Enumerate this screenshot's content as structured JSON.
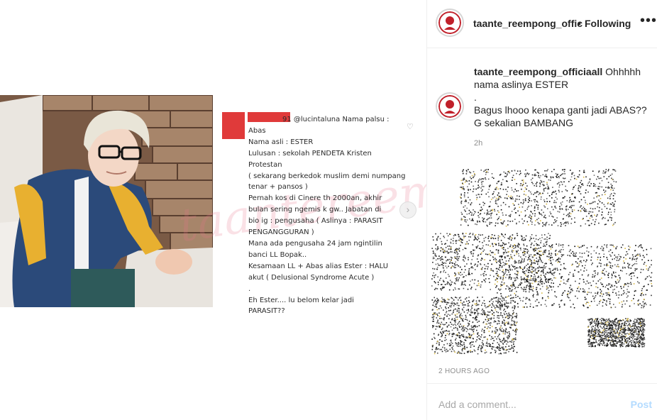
{
  "header": {
    "username": "taante_reempong_offic",
    "separator": "•",
    "follow_label": "Following",
    "more_label": "•••"
  },
  "caption": {
    "username": "taante_reempong_officiaall",
    "lines": [
      "Ohhhhh",
      "nama aslinya ESTER",
      ".",
      "Bagus lhooo kenapa ganti jadi ABAS??",
      "G sekalian BAMBANG"
    ],
    "time": "2h"
  },
  "post_comment": {
    "mention": "91 @lucintaluna Nama palsu :",
    "lines": [
      "Abas",
      "Nama asli : ESTER",
      "Lulusan : sekolah PENDETA Kristen",
      "Protestan",
      "( sekarang berkedok muslim demi numpang",
      "tenar + pansos )",
      "Pernah kos di Cinere th 2000an, akhir",
      "bulan sering ngemis k gw.. Jabatan di",
      "bio ig : pengusaha ( Aslinya : PARASIT",
      "PENGANGGURAN )",
      "Mana ada pengusaha 24 jam ngintilin",
      "banci LL Bopak..",
      "Kesamaan LL + Abas alias Ester : HALU",
      "akut ( Delusional Syndrome Acute )",
      ".",
      "Eh Ester.... lu belom kelar jadi",
      "PARASIT??"
    ]
  },
  "timestamp": "2 HOURS AGO",
  "add_comment": {
    "placeholder": "Add a comment...",
    "post_label": "Post"
  },
  "icons": {
    "heart": "♡",
    "next": "›"
  },
  "colors": {
    "redaction": "#e03a3a",
    "post_disabled": "#b3dbff",
    "secondary_text": "#8e8e8e"
  }
}
